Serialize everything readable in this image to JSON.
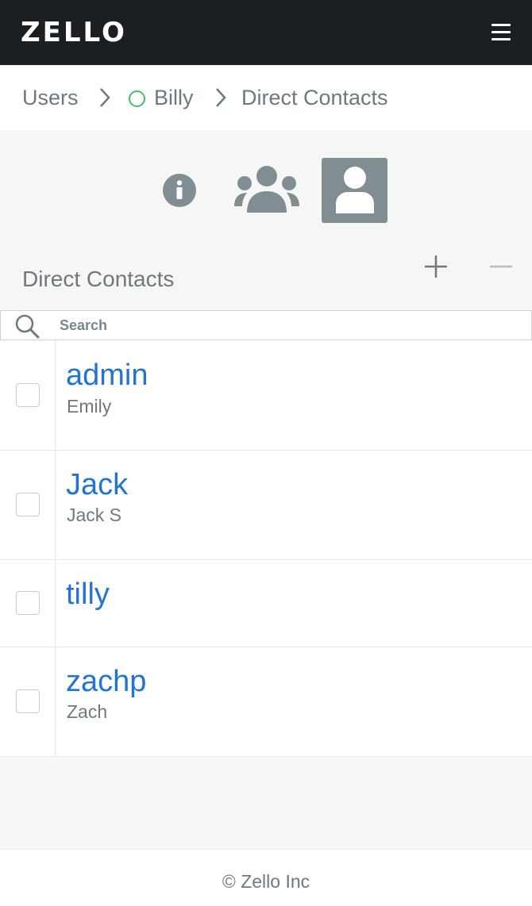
{
  "header": {
    "logo_text": "ZELLO",
    "menu_icon": "hamburger-menu-icon"
  },
  "breadcrumb": {
    "items": [
      {
        "label": "Users"
      },
      {
        "label": "Billy",
        "status": "online-outline"
      },
      {
        "label": "Direct Contacts"
      }
    ]
  },
  "tabs": [
    {
      "icon": "info-icon",
      "active": false
    },
    {
      "icon": "group-icon",
      "active": false
    },
    {
      "icon": "user-icon",
      "active": true
    }
  ],
  "section": {
    "title": "Direct Contacts",
    "add_icon": "plus-icon",
    "remove_icon": "minus-icon"
  },
  "search": {
    "placeholder": "Search",
    "value": ""
  },
  "contacts": [
    {
      "username": "admin",
      "full_name": "Emily"
    },
    {
      "username": "Jack",
      "full_name": "Jack S"
    },
    {
      "username": "tilly",
      "full_name": ""
    },
    {
      "username": "zachp",
      "full_name": "Zach"
    }
  ],
  "footer": {
    "copyright": "© Zello Inc"
  },
  "colors": {
    "header_bg": "#1c1f21",
    "link_blue": "#2273d3",
    "muted_text": "#6c7a80",
    "active_tab_bg": "#808e94",
    "status_green": "#3fbf6c"
  }
}
